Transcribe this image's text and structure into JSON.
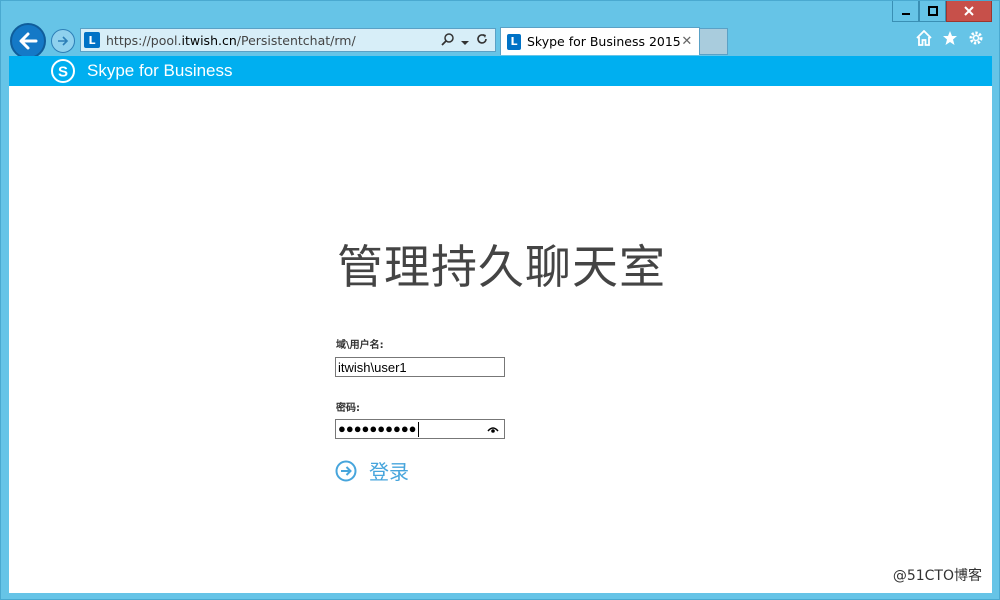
{
  "browser": {
    "address": {
      "url_prefix": "https://pool.",
      "url_host": "itwish.cn",
      "url_path": "/Persistentchat/rm/",
      "site_icon_letter": "L"
    },
    "tab": {
      "title": "Skype for Business 2015",
      "close_glyph": "✕"
    },
    "toolbar_icons": [
      "home-icon",
      "favorites-star-icon",
      "settings-gear-icon"
    ],
    "caption_buttons": [
      "minimize",
      "maximize",
      "close"
    ]
  },
  "app_header": {
    "title": "Skype for Business",
    "brand_color": "#00aff0"
  },
  "login_form": {
    "page_title": "管理持久聊天室",
    "username_label": "域\\用户名:",
    "username_value": "itwish\\user1",
    "password_label": "密码:",
    "password_masked": "●●●●●●●●●●",
    "signin_label": "登录",
    "accent_color": "#47a5dc"
  },
  "watermark": {
    "text": "@51CTO博客"
  }
}
